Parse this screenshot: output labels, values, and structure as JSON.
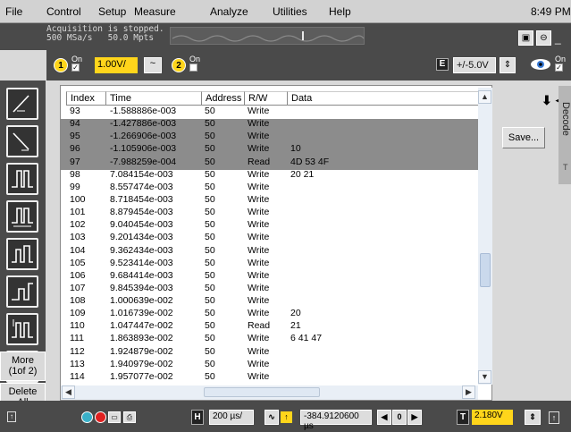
{
  "menu": {
    "items": [
      "File",
      "Control",
      "Setup",
      "Measure",
      "Analyze",
      "Utilities",
      "Help"
    ],
    "clock": "8:49 PM"
  },
  "status": {
    "line1": "Acquisition is stopped.",
    "line2": "500 MSa/s   50.0 Mpts"
  },
  "channel": {
    "ch1_number": "1",
    "ch1_on_label": "On",
    "ch1_scale": "1.00V/",
    "coupling": "~",
    "ch2_number": "2",
    "ch2_on_label": "On",
    "trigger_letter": "E",
    "trigger_value": "+/-5.0V",
    "display_on_label": "On"
  },
  "left_toolbar": {
    "more_label": "More",
    "more_page": "(1of 2)",
    "delete_label": "Delete",
    "delete_sub": "All",
    "icons": [
      "rising-edge-trigger-icon",
      "falling-edge-trigger-icon",
      "pulse-width-trigger-icon",
      "pattern-trigger-icon",
      "runt-trigger-icon",
      "setup-hold-trigger-icon",
      "timeout-trigger-icon",
      "transition-trigger-icon"
    ]
  },
  "table": {
    "columns": [
      "Index",
      "Time",
      "Address",
      "R/W",
      "Data"
    ],
    "rows": [
      {
        "index": "93",
        "time": "-1.588886e-003",
        "address": "50",
        "rw": "Write",
        "data": "",
        "selected": false
      },
      {
        "index": "94",
        "time": "-1.427886e-003",
        "address": "50",
        "rw": "Write",
        "data": "",
        "selected": true
      },
      {
        "index": "95",
        "time": "-1.266906e-003",
        "address": "50",
        "rw": "Write",
        "data": "",
        "selected": true
      },
      {
        "index": "96",
        "time": "-1.105906e-003",
        "address": "50",
        "rw": "Write",
        "data": "10",
        "selected": true
      },
      {
        "index": "97",
        "time": "-7.988259e-004",
        "address": "50",
        "rw": "Read",
        "data": "4D 53 4F",
        "selected": true
      },
      {
        "index": "98",
        "time": "7.084154e-003",
        "address": "50",
        "rw": "Write",
        "data": "20 21",
        "selected": false
      },
      {
        "index": "99",
        "time": "8.557474e-003",
        "address": "50",
        "rw": "Write",
        "data": "",
        "selected": false
      },
      {
        "index": "100",
        "time": "8.718454e-003",
        "address": "50",
        "rw": "Write",
        "data": "",
        "selected": false
      },
      {
        "index": "101",
        "time": "8.879454e-003",
        "address": "50",
        "rw": "Write",
        "data": "",
        "selected": false
      },
      {
        "index": "102",
        "time": "9.040454e-003",
        "address": "50",
        "rw": "Write",
        "data": "",
        "selected": false
      },
      {
        "index": "103",
        "time": "9.201434e-003",
        "address": "50",
        "rw": "Write",
        "data": "",
        "selected": false
      },
      {
        "index": "104",
        "time": "9.362434e-003",
        "address": "50",
        "rw": "Write",
        "data": "",
        "selected": false
      },
      {
        "index": "105",
        "time": "9.523414e-003",
        "address": "50",
        "rw": "Write",
        "data": "",
        "selected": false
      },
      {
        "index": "106",
        "time": "9.684414e-003",
        "address": "50",
        "rw": "Write",
        "data": "",
        "selected": false
      },
      {
        "index": "107",
        "time": "9.845394e-003",
        "address": "50",
        "rw": "Write",
        "data": "",
        "selected": false
      },
      {
        "index": "108",
        "time": "1.000639e-002",
        "address": "50",
        "rw": "Write",
        "data": "",
        "selected": false
      },
      {
        "index": "109",
        "time": "1.016739e-002",
        "address": "50",
        "rw": "Write",
        "data": "20",
        "selected": false
      },
      {
        "index": "110",
        "time": "1.047447e-002",
        "address": "50",
        "rw": "Read",
        "data": "21",
        "selected": false
      },
      {
        "index": "111",
        "time": "1.863893e-002",
        "address": "50",
        "rw": "Write",
        "data": "6 41 47",
        "selected": false
      },
      {
        "index": "112",
        "time": "1.924879e-002",
        "address": "50",
        "rw": "Write",
        "data": "",
        "selected": false
      },
      {
        "index": "113",
        "time": "1.940979e-002",
        "address": "50",
        "rw": "Write",
        "data": "",
        "selected": false
      },
      {
        "index": "114",
        "time": "1.957077e-002",
        "address": "50",
        "rw": "Write",
        "data": "",
        "selected": false
      }
    ]
  },
  "right_panel": {
    "decode_tab": "Decode",
    "save_label": "Save...",
    "t_label": "T"
  },
  "bottom": {
    "h_letter": "H",
    "timebase": "200 µs/",
    "delay": "-384.9120600 µs",
    "t_letter": "T",
    "trigger_level": "2.180V"
  }
}
